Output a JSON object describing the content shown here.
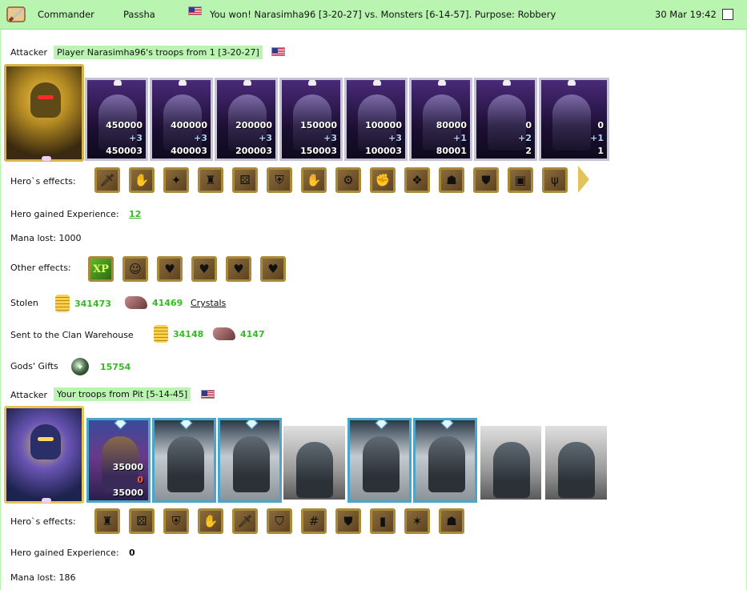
{
  "header": {
    "role": "Commander",
    "player": "Passha",
    "message": "You won! Narasimha96 [3-20-27] vs. Monsters [6-14-57]. Purpose: Robbery",
    "datetime": "30 Mar 19:42",
    "bg_color": "#b9f5b0"
  },
  "section1": {
    "attacker_label": "Attacker",
    "attacker_value": "Player Narasimha96's troops from 1 [3-20-27]",
    "troops": [
      {
        "v1": "450000",
        "v2": "+3",
        "v3": "450003"
      },
      {
        "v1": "400000",
        "v2": "+3",
        "v3": "400003"
      },
      {
        "v1": "200000",
        "v2": "+3",
        "v3": "200003"
      },
      {
        "v1": "150000",
        "v2": "+3",
        "v3": "150003"
      },
      {
        "v1": "100000",
        "v2": "+3",
        "v3": "100003"
      },
      {
        "v1": "80000",
        "v2": "+1",
        "v3": "80001"
      },
      {
        "v1": "0",
        "v2": "+2",
        "v3": "2"
      },
      {
        "v1": "0",
        "v2": "+1",
        "v3": "1"
      }
    ],
    "hero_effects_label": "Hero`s effects:",
    "hero_exp_label": "Hero gained Experience:",
    "hero_exp_value": "12",
    "mana_lost": "Mana lost: 1000",
    "other_effects_label": "Other effects:",
    "other_effects_xp": "XP",
    "stolen_label": "Stolen",
    "stolen_gold": "341473",
    "stolen_ore": "41469",
    "crystals_link": "Crystals",
    "clan_label": "Sent to the Clan Warehouse",
    "clan_gold": "34148",
    "clan_ore": "4147",
    "gods_label": "Gods' Gifts",
    "gods_value": "15754"
  },
  "section2": {
    "attacker_label": "Attacker",
    "attacker_value": "Your troops from Pit [5-14-45]",
    "troop1": {
      "v1": "35000",
      "v2": "0",
      "v3": "35000"
    },
    "hero_effects_label": "Hero`s effects:",
    "hero_exp_label": "Hero gained Experience:",
    "hero_exp_value": "0",
    "mana_lost": "Mana lost: 186"
  },
  "icons": {
    "header": "sword-scroll-icon",
    "flag": "us-flag-icon",
    "gold": "gold-coins-icon",
    "ore": "ore-icon",
    "gift": "gods-gift-orb-icon"
  },
  "colors": {
    "highlight": "#b9f5b0",
    "value_green": "#33bb22"
  }
}
